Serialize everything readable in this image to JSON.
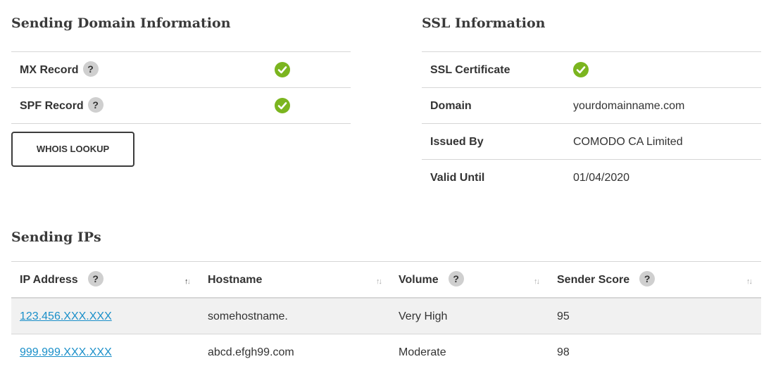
{
  "domain_info": {
    "title": "Sending Domain Information",
    "rows": [
      {
        "label": "MX Record",
        "help": "?",
        "status": "ok"
      },
      {
        "label": "SPF Record",
        "help": "?",
        "status": "ok"
      }
    ],
    "whois_button": "WHOIS LOOKUP"
  },
  "ssl_info": {
    "title": "SSL Information",
    "certificate_label": "SSL Certificate",
    "certificate_status": "ok",
    "rows": [
      {
        "label": "Domain",
        "value": "yourdomainname.com"
      },
      {
        "label": "Issued By",
        "value": "COMODO CA Limited"
      },
      {
        "label": "Valid Until",
        "value": "01/04/2020"
      }
    ]
  },
  "sending_ips": {
    "title": "Sending IPs",
    "columns": [
      {
        "label": "IP Address",
        "help": "?",
        "sort": "asc"
      },
      {
        "label": "Hostname",
        "sort": "none"
      },
      {
        "label": "Volume",
        "help": "?",
        "sort": "none"
      },
      {
        "label": "Sender Score",
        "help": "?",
        "sort": "none"
      }
    ],
    "sort_glyphs": {
      "up": "↑",
      "down": "↓"
    },
    "rows": [
      {
        "ip": "123.456.XXX.XXX",
        "hostname": "somehostname.",
        "volume": "Very High",
        "score": "95"
      },
      {
        "ip": "999.999.XXX.XXX",
        "hostname": "abcd.efgh99.com",
        "volume": "Moderate",
        "score": "98"
      }
    ]
  },
  "colors": {
    "check_green": "#7bb51f",
    "link_blue": "#1a8fc9",
    "help_gray": "#cfcfcf",
    "border": "#d6d6d6",
    "row_highlight": "#f1f1f1"
  },
  "icons": {
    "check": "check-circle-icon",
    "help": "question-circle-icon",
    "sort": "sort-arrows-icon"
  }
}
